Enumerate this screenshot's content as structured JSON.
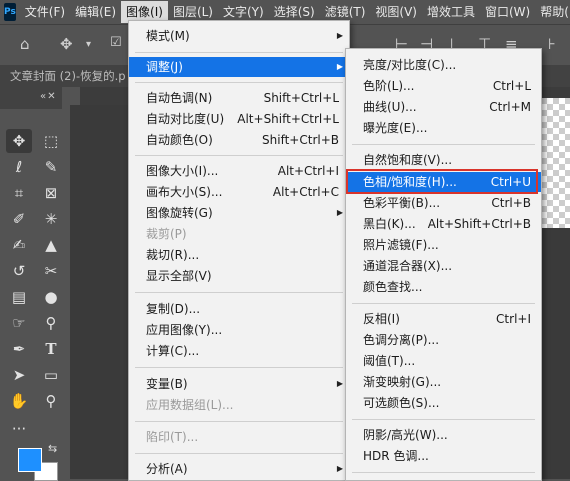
{
  "app": {
    "logo": "Ps"
  },
  "menubar": [
    {
      "label": "文件(F)"
    },
    {
      "label": "编辑(E)"
    },
    {
      "label": "图像(I)"
    },
    {
      "label": "图层(L)"
    },
    {
      "label": "文字(Y)"
    },
    {
      "label": "选择(S)"
    },
    {
      "label": "滤镜(T)"
    },
    {
      "label": "视图(V)"
    },
    {
      "label": "增效工具"
    },
    {
      "label": "窗口(W)"
    },
    {
      "label": "帮助("
    }
  ],
  "document": {
    "tab_title": "文章封面 (2)-恢复的.p"
  },
  "image_menu": [
    {
      "label": "模式(M)",
      "shortcut": "",
      "submenu": true
    },
    {
      "label": "调整(J)",
      "shortcut": "",
      "submenu": true,
      "highlighted": true
    },
    {
      "label": "自动色调(N)",
      "shortcut": "Shift+Ctrl+L"
    },
    {
      "label": "自动对比度(U)",
      "shortcut": "Alt+Shift+Ctrl+L"
    },
    {
      "label": "自动颜色(O)",
      "shortcut": "Shift+Ctrl+B"
    },
    {
      "label": "图像大小(I)...",
      "shortcut": "Alt+Ctrl+I"
    },
    {
      "label": "画布大小(S)...",
      "shortcut": "Alt+Ctrl+C"
    },
    {
      "label": "图像旋转(G)",
      "shortcut": "",
      "submenu": true
    },
    {
      "label": "裁剪(P)",
      "shortcut": "",
      "disabled": true
    },
    {
      "label": "裁切(R)...",
      "shortcut": ""
    },
    {
      "label": "显示全部(V)",
      "shortcut": ""
    },
    {
      "label": "复制(D)...",
      "shortcut": ""
    },
    {
      "label": "应用图像(Y)...",
      "shortcut": ""
    },
    {
      "label": "计算(C)...",
      "shortcut": ""
    },
    {
      "label": "变量(B)",
      "shortcut": "",
      "submenu": true
    },
    {
      "label": "应用数据组(L)...",
      "shortcut": "",
      "disabled": true
    },
    {
      "label": "陷印(T)...",
      "shortcut": "",
      "disabled": true
    },
    {
      "label": "分析(A)",
      "shortcut": "",
      "submenu": true
    }
  ],
  "adjust_menu": [
    {
      "label": "亮度/对比度(C)...",
      "shortcut": ""
    },
    {
      "label": "色阶(L)...",
      "shortcut": "Ctrl+L"
    },
    {
      "label": "曲线(U)...",
      "shortcut": "Ctrl+M"
    },
    {
      "label": "曝光度(E)...",
      "shortcut": ""
    },
    {
      "label": "自然饱和度(V)...",
      "shortcut": ""
    },
    {
      "label": "色相/饱和度(H)...",
      "shortcut": "Ctrl+U",
      "highlighted": true
    },
    {
      "label": "色彩平衡(B)...",
      "shortcut": "Ctrl+B"
    },
    {
      "label": "黑白(K)...",
      "shortcut": "Alt+Shift+Ctrl+B"
    },
    {
      "label": "照片滤镜(F)...",
      "shortcut": ""
    },
    {
      "label": "通道混合器(X)...",
      "shortcut": ""
    },
    {
      "label": "颜色查找...",
      "shortcut": ""
    },
    {
      "label": "反相(I)",
      "shortcut": "Ctrl+I"
    },
    {
      "label": "色调分离(P)...",
      "shortcut": ""
    },
    {
      "label": "阈值(T)...",
      "shortcut": ""
    },
    {
      "label": "渐变映射(G)...",
      "shortcut": ""
    },
    {
      "label": "可选颜色(S)...",
      "shortcut": ""
    },
    {
      "label": "阴影/高光(W)...",
      "shortcut": ""
    },
    {
      "label": "HDR 色调...",
      "shortcut": ""
    }
  ],
  "tools": [
    {
      "icon": "move-tool-icon",
      "glyph": "✥"
    },
    {
      "icon": "marquee-tool-icon",
      "glyph": "⬚"
    },
    {
      "icon": "lasso-tool-icon",
      "glyph": "ℓ"
    },
    {
      "icon": "quick-select-tool-icon",
      "glyph": "✎"
    },
    {
      "icon": "crop-tool-icon",
      "glyph": "⌗"
    },
    {
      "icon": "frame-tool-icon",
      "glyph": "⊠"
    },
    {
      "icon": "eyedropper-tool-icon",
      "glyph": "✐"
    },
    {
      "icon": "spot-heal-tool-icon",
      "glyph": "✳"
    },
    {
      "icon": "brush-tool-icon",
      "glyph": "✍"
    },
    {
      "icon": "stamp-tool-icon",
      "glyph": "▲"
    },
    {
      "icon": "history-brush-tool-icon",
      "glyph": "↺"
    },
    {
      "icon": "eraser-tool-icon",
      "glyph": "✂"
    },
    {
      "icon": "gradient-tool-icon",
      "glyph": "▤"
    },
    {
      "icon": "blur-tool-icon",
      "glyph": "●"
    },
    {
      "icon": "smudge-tool-icon",
      "glyph": "☞"
    },
    {
      "icon": "dodge-tool-icon",
      "glyph": "⚲"
    },
    {
      "icon": "pen-tool-icon",
      "glyph": "✒"
    },
    {
      "icon": "type-tool-icon",
      "glyph": "T"
    },
    {
      "icon": "path-select-tool-icon",
      "glyph": "➤"
    },
    {
      "icon": "rectangle-tool-icon",
      "glyph": "▭"
    },
    {
      "icon": "hand-tool-icon",
      "glyph": "✋"
    },
    {
      "icon": "zoom-tool-icon",
      "glyph": "⚲"
    },
    {
      "icon": "more-tools-icon",
      "glyph": "···"
    }
  ],
  "colors": {
    "foreground": "#1e90ff",
    "background": "#ffffff",
    "highlight": "#1473e6",
    "annotation_box": "#d9342b"
  }
}
